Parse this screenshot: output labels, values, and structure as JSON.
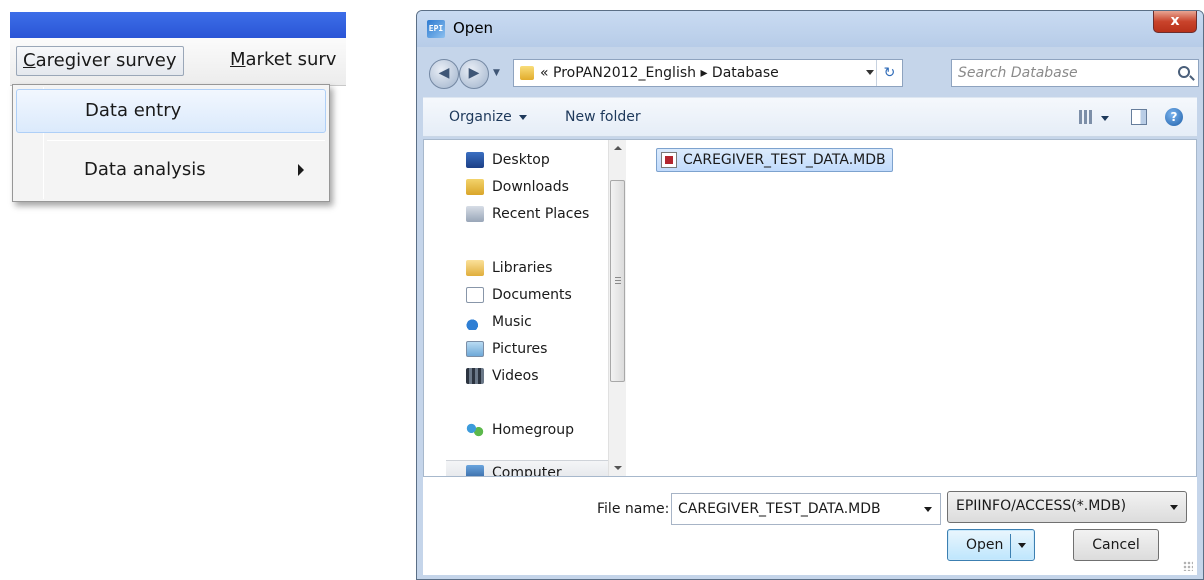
{
  "menu": {
    "caregiver_label": "Caregiver survey",
    "caregiver_accel": "C",
    "caregiver_rest": "aregiver survey",
    "market_accel": "M",
    "market_rest": "arket surv",
    "dropdown": {
      "items": [
        {
          "label": "Data entry"
        },
        {
          "label": "Data analysis"
        }
      ]
    }
  },
  "dialog": {
    "title": "Open",
    "close_glyph": "x",
    "address_path": "« ProPAN2012_English ▸ Database",
    "search_placeholder": "Search Database",
    "toolbar": {
      "organize_label": "Organize",
      "new_folder_label": "New folder"
    },
    "nav_pane": {
      "items": [
        {
          "label": "Desktop",
          "icon": "desktop-icon"
        },
        {
          "label": "Downloads",
          "icon": "downloads-icon"
        },
        {
          "label": "Recent Places",
          "icon": "recent-places-icon"
        },
        {
          "label": "Libraries",
          "icon": "libraries-icon"
        },
        {
          "label": "Documents",
          "icon": "documents-icon"
        },
        {
          "label": "Music",
          "icon": "music-icon"
        },
        {
          "label": "Pictures",
          "icon": "pictures-icon"
        },
        {
          "label": "Videos",
          "icon": "videos-icon"
        },
        {
          "label": "Homegroup",
          "icon": "homegroup-icon"
        },
        {
          "label": "Computer",
          "icon": "computer-icon"
        }
      ]
    },
    "files": [
      {
        "name": "CAREGIVER_TEST_DATA.MDB",
        "selected": true
      }
    ],
    "file_name_label": "File name:",
    "file_name_value": "CAREGIVER_TEST_DATA.MDB",
    "file_type": "EPIINFO/ACCESS(*.MDB)",
    "open_button": "Open",
    "cancel_button": "Cancel"
  },
  "colors": {
    "app_titlebar": "#2a55d6",
    "selection": "#c1dbfc",
    "close_button": "#c9432b"
  }
}
